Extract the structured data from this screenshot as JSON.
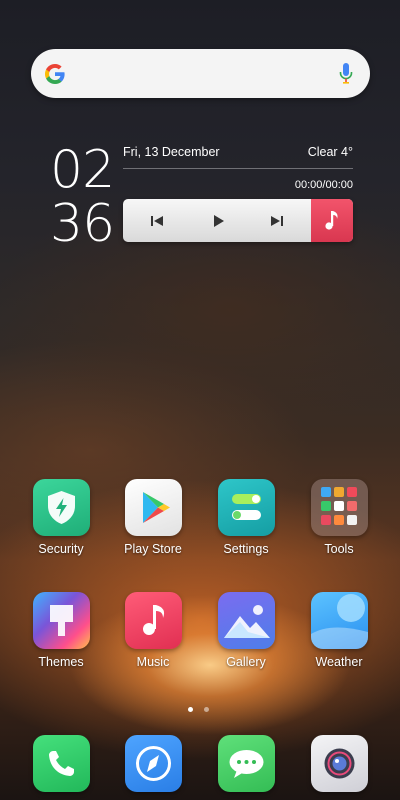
{
  "search": {
    "google_icon": "google-g-icon",
    "mic_icon": "mic-icon"
  },
  "clock": {
    "hours": "02",
    "minutes": "36"
  },
  "widget": {
    "date": "Fri, 13 December",
    "weather": "Clear 4°",
    "timer": "00:00/00:00"
  },
  "player": {
    "prev_icon": "previous-icon",
    "play_icon": "play-icon",
    "next_icon": "next-icon",
    "music_icon": "music-note-icon"
  },
  "apps": {
    "row1": [
      {
        "label": "Security",
        "icon": "shield-icon",
        "color": "#27c28a"
      },
      {
        "label": "Play Store",
        "icon": "play-store-icon",
        "color": "#f2f2f2"
      },
      {
        "label": "Settings",
        "icon": "toggle-icon",
        "color": "#1fb6b9"
      },
      {
        "label": "Tools",
        "icon": "folder-icon",
        "color": "#6b5a55"
      }
    ],
    "row2": [
      {
        "label": "Themes",
        "icon": "brush-icon",
        "color": "#7a55d8"
      },
      {
        "label": "Music",
        "icon": "music-note-icon",
        "color": "#ef3f60"
      },
      {
        "label": "Gallery",
        "icon": "mountain-icon",
        "color": "#5b70e8"
      },
      {
        "label": "Weather",
        "icon": "weather-icon",
        "color": "#3aa9f0"
      }
    ]
  },
  "dock": [
    {
      "icon": "phone-icon",
      "color": "#2fcf6a"
    },
    {
      "icon": "browser-icon",
      "color": "#3b8ff0"
    },
    {
      "icon": "messages-icon",
      "color": "#4ed36a"
    },
    {
      "icon": "camera-icon",
      "color": "#e8e8ec"
    }
  ],
  "pager": {
    "pages": 2,
    "active": 1
  }
}
